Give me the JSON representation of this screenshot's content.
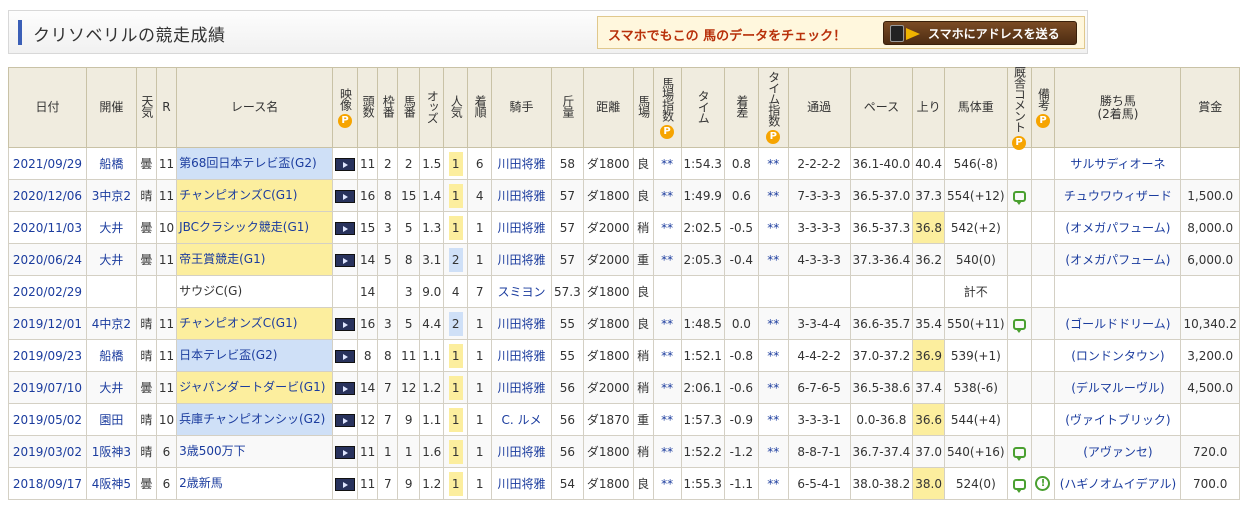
{
  "header": {
    "title": "クリソベリルの競走成績",
    "promo_text": "スマホでもこの 馬のデータをチェック！",
    "promo_button": "スマホにアドレスを送る"
  },
  "columns": {
    "date": "日付",
    "venue": "開催",
    "weather": "天気",
    "race_no": "R",
    "race_name": "レース名",
    "video": "映像",
    "field_size": "頭数",
    "frame": "枠番",
    "horse_no": "馬番",
    "odds": "オッズ",
    "popularity": "人気",
    "finish": "着順",
    "jockey": "騎手",
    "weight_carried": "斤量",
    "distance": "距離",
    "track_cond": "馬場",
    "track_index": "馬場指数",
    "time": "タイム",
    "margin": "着差",
    "time_index": "タイム指数",
    "passing": "通過",
    "pace": "ペース",
    "last3f": "上り",
    "body_weight": "馬体重",
    "stable_comment": "厩舎コメント",
    "remarks": "備考",
    "winner": "勝ち馬",
    "winner_sub": "(2着馬)",
    "prize": "賞金",
    "premium_mark": "P"
  },
  "rows": [
    {
      "date": "2021/09/29",
      "venue": "船橋",
      "weather": "曇",
      "race_no": "11",
      "race_name": "第68回日本テレビ盃(G2)",
      "grade": "g2",
      "video": true,
      "field_size": "11",
      "frame": "2",
      "horse_no": "2",
      "odds": "1.5",
      "popularity": "1",
      "finish": "6",
      "jockey": "川田将雅",
      "weight_carried": "58",
      "distance": "ダ1800",
      "track_cond": "良",
      "track_index": "**",
      "time": "1:54.3",
      "margin": "0.8",
      "time_index": "**",
      "passing": "2-2-2-2",
      "pace": "36.1-40.0",
      "last3f": "40.4",
      "agari_rank": "",
      "body_weight": "546(-8)",
      "comment": false,
      "remark": false,
      "winner": "サルサディオーネ",
      "prize": ""
    },
    {
      "date": "2020/12/06",
      "venue": "3中京2",
      "weather": "晴",
      "race_no": "11",
      "race_name": "チャンピオンズC(G1)",
      "grade": "g1",
      "video": true,
      "field_size": "16",
      "frame": "8",
      "horse_no": "15",
      "odds": "1.4",
      "popularity": "1",
      "finish": "4",
      "jockey": "川田将雅",
      "weight_carried": "57",
      "distance": "ダ1800",
      "track_cond": "良",
      "track_index": "**",
      "time": "1:49.9",
      "margin": "0.6",
      "time_index": "**",
      "passing": "7-3-3-3",
      "pace": "36.5-37.0",
      "last3f": "37.3",
      "agari_rank": "",
      "body_weight": "554(+12)",
      "comment": true,
      "remark": false,
      "winner": "チュウワウィザード",
      "prize": "1,500.0"
    },
    {
      "date": "2020/11/03",
      "venue": "大井",
      "weather": "曇",
      "race_no": "10",
      "race_name": "JBCクラシック競走(G1)",
      "grade": "g1",
      "video": true,
      "field_size": "15",
      "frame": "3",
      "horse_no": "5",
      "odds": "1.3",
      "popularity": "1",
      "finish": "1",
      "jockey": "川田将雅",
      "weight_carried": "57",
      "distance": "ダ2000",
      "track_cond": "稍",
      "track_index": "**",
      "time": "2:02.5",
      "margin": "-0.5",
      "time_index": "**",
      "passing": "3-3-3-3",
      "pace": "36.5-37.3",
      "last3f": "36.8",
      "agari_rank": "1",
      "body_weight": "542(+2)",
      "comment": false,
      "remark": false,
      "winner": "(オメガパフューム)",
      "prize": "8,000.0"
    },
    {
      "date": "2020/06/24",
      "venue": "大井",
      "weather": "曇",
      "race_no": "11",
      "race_name": "帝王賞競走(G1)",
      "grade": "g1",
      "video": true,
      "field_size": "14",
      "frame": "5",
      "horse_no": "8",
      "odds": "3.1",
      "popularity": "2",
      "finish": "1",
      "jockey": "川田将雅",
      "weight_carried": "57",
      "distance": "ダ2000",
      "track_cond": "重",
      "track_index": "**",
      "time": "2:05.3",
      "margin": "-0.4",
      "time_index": "**",
      "passing": "4-3-3-3",
      "pace": "37.3-36.4",
      "last3f": "36.2",
      "agari_rank": "1",
      "body_weight": "540(0)",
      "comment": false,
      "remark": false,
      "winner": "(オメガパフューム)",
      "prize": "6,000.0"
    },
    {
      "date": "2020/02/29",
      "venue": "",
      "weather": "",
      "race_no": "",
      "race_name": "サウジC(G)",
      "grade": "",
      "video": false,
      "field_size": "14",
      "frame": "",
      "horse_no": "3",
      "odds": "9.0",
      "popularity": "4",
      "finish": "7",
      "jockey": "スミヨン",
      "weight_carried": "57.3",
      "distance": "ダ1800",
      "track_cond": "良",
      "track_index": "",
      "time": "",
      "margin": "",
      "time_index": "",
      "passing": "",
      "pace": "",
      "last3f": "",
      "agari_rank": "",
      "body_weight": "計不",
      "comment": false,
      "remark": false,
      "winner": "",
      "prize": ""
    },
    {
      "date": "2019/12/01",
      "venue": "4中京2",
      "weather": "晴",
      "race_no": "11",
      "race_name": "チャンピオンズC(G1)",
      "grade": "g1",
      "video": true,
      "field_size": "16",
      "frame": "3",
      "horse_no": "5",
      "odds": "4.4",
      "popularity": "2",
      "finish": "1",
      "jockey": "川田将雅",
      "weight_carried": "55",
      "distance": "ダ1800",
      "track_cond": "良",
      "track_index": "**",
      "time": "1:48.5",
      "margin": "0.0",
      "time_index": "**",
      "passing": "3-3-4-4",
      "pace": "36.6-35.7",
      "last3f": "35.4",
      "agari_rank": "2",
      "body_weight": "550(+11)",
      "comment": true,
      "remark": false,
      "winner": "(ゴールドドリーム)",
      "prize": "10,340.2"
    },
    {
      "date": "2019/09/23",
      "venue": "船橋",
      "weather": "晴",
      "race_no": "11",
      "race_name": "日本テレビ盃(G2)",
      "grade": "g2",
      "video": true,
      "field_size": "8",
      "frame": "8",
      "horse_no": "11",
      "odds": "1.1",
      "popularity": "1",
      "finish": "1",
      "jockey": "川田将雅",
      "weight_carried": "55",
      "distance": "ダ1800",
      "track_cond": "稍",
      "track_index": "**",
      "time": "1:52.1",
      "margin": "-0.8",
      "time_index": "**",
      "passing": "4-4-2-2",
      "pace": "37.0-37.2",
      "last3f": "36.9",
      "agari_rank": "1",
      "body_weight": "539(+1)",
      "comment": false,
      "remark": false,
      "winner": "(ロンドンタウン)",
      "prize": "3,200.0"
    },
    {
      "date": "2019/07/10",
      "venue": "大井",
      "weather": "曇",
      "race_no": "11",
      "race_name": "ジャパンダートダービ(G1)",
      "grade": "g1",
      "video": true,
      "field_size": "14",
      "frame": "7",
      "horse_no": "12",
      "odds": "1.2",
      "popularity": "1",
      "finish": "1",
      "jockey": "川田将雅",
      "weight_carried": "56",
      "distance": "ダ2000",
      "track_cond": "稍",
      "track_index": "**",
      "time": "2:06.1",
      "margin": "-0.6",
      "time_index": "**",
      "passing": "6-7-6-5",
      "pace": "36.5-38.6",
      "last3f": "37.4",
      "agari_rank": "2",
      "body_weight": "538(-6)",
      "comment": false,
      "remark": false,
      "winner": "(デルマルーヴル)",
      "prize": "4,500.0"
    },
    {
      "date": "2019/05/02",
      "venue": "園田",
      "weather": "晴",
      "race_no": "10",
      "race_name": "兵庫チャンピオンシッ(G2)",
      "grade": "g2",
      "video": true,
      "field_size": "12",
      "frame": "7",
      "horse_no": "9",
      "odds": "1.1",
      "popularity": "1",
      "finish": "1",
      "jockey": "C. ルメ",
      "weight_carried": "56",
      "distance": "ダ1870",
      "track_cond": "重",
      "track_index": "**",
      "time": "1:57.3",
      "margin": "-0.9",
      "time_index": "**",
      "passing": "3-3-3-1",
      "pace": "0.0-36.8",
      "last3f": "36.6",
      "agari_rank": "1",
      "body_weight": "544(+4)",
      "comment": false,
      "remark": false,
      "winner": "(ヴァイトブリック)",
      "prize": ""
    },
    {
      "date": "2019/03/02",
      "venue": "1阪神3",
      "weather": "晴",
      "race_no": "6",
      "race_name": "3歳500万下",
      "grade": "",
      "video": true,
      "field_size": "11",
      "frame": "1",
      "horse_no": "1",
      "odds": "1.6",
      "popularity": "1",
      "finish": "1",
      "jockey": "川田将雅",
      "weight_carried": "56",
      "distance": "ダ1800",
      "track_cond": "稍",
      "track_index": "**",
      "time": "1:52.2",
      "margin": "-1.2",
      "time_index": "**",
      "passing": "8-8-7-1",
      "pace": "36.7-37.4",
      "last3f": "37.0",
      "agari_rank": "1",
      "body_weight": "540(+16)",
      "comment": true,
      "remark": false,
      "winner": "(アヴァンセ)",
      "prize": "720.0"
    },
    {
      "date": "2018/09/17",
      "venue": "4阪神5",
      "weather": "曇",
      "race_no": "6",
      "race_name": "2歳新馬",
      "grade": "",
      "video": true,
      "field_size": "11",
      "frame": "7",
      "horse_no": "9",
      "odds": "1.2",
      "popularity": "1",
      "finish": "1",
      "jockey": "川田将雅",
      "weight_carried": "54",
      "distance": "ダ1800",
      "track_cond": "良",
      "track_index": "**",
      "time": "1:55.3",
      "margin": "-1.1",
      "time_index": "**",
      "passing": "6-5-4-1",
      "pace": "38.0-38.2",
      "last3f": "38.0",
      "agari_rank": "1",
      "body_weight": "524(0)",
      "comment": true,
      "remark": true,
      "remark_icon": "exclamation-icon",
      "winner": "(ハギノオムイデアル)",
      "prize": "700.0"
    }
  ]
}
